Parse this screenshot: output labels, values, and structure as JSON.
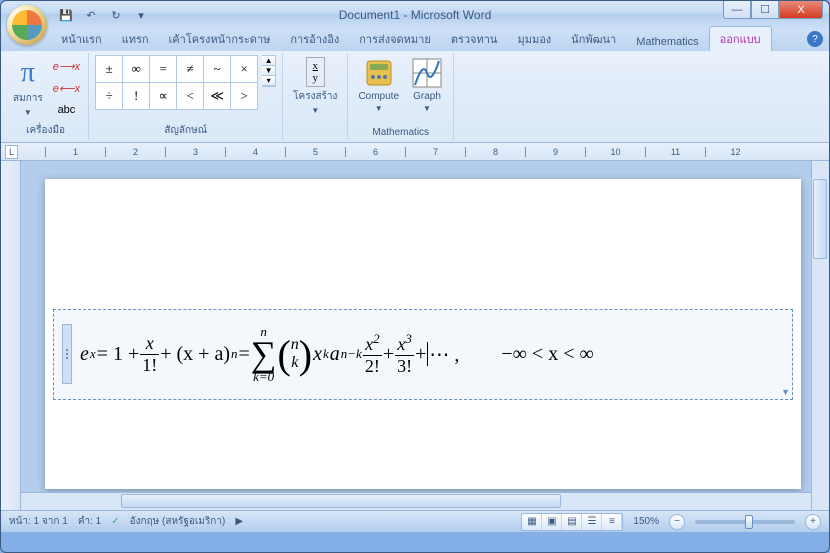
{
  "title": "Document1 - Microsoft Word",
  "tabs": {
    "items": [
      "หน้าแรก",
      "แทรก",
      "เค้าโครงหน้ากระดาษ",
      "การอ้างอิง",
      "การส่งจดหมาย",
      "ตรวจทาน",
      "มุมมอง",
      "นักพัฒนา",
      "Mathematics",
      "ออกแบบ"
    ],
    "active_index": 9
  },
  "ribbon": {
    "tools": {
      "label": "เครื่องมือ",
      "equation": "สมการ",
      "e1": "e⟶x",
      "e2": "e⟵x",
      "abc": "abc"
    },
    "symbols": {
      "label": "สัญลักษณ์",
      "grid": [
        "±",
        "∞",
        "=",
        "≠",
        "~",
        "×",
        "÷",
        "!",
        "∝",
        "<",
        "≪",
        ">"
      ]
    },
    "structures": {
      "label": "โครงสร้าง",
      "frac": "x/y"
    },
    "mathematics": {
      "label": "Mathematics",
      "compute": "Compute",
      "graph": "Graph"
    }
  },
  "ruler_numbers": [
    "1",
    "2",
    "3",
    "4",
    "5",
    "6",
    "7",
    "8",
    "9",
    "10",
    "11",
    "12"
  ],
  "equation": {
    "lhs": "e",
    "lhs_sup": "x",
    "eq": " = 1 + ",
    "f1n": "x",
    "f1d": "1!",
    "plus1": " + (x + a)",
    "sup_n": "n",
    "eq2": " = ",
    "sum_top": "n",
    "sum_bot": "k=0",
    "binom_n": "n",
    "binom_k": "k",
    "mid": " x",
    "mid_sup": "k",
    "mid2": " a",
    "mid2_sup": "n−k",
    "f2n_base": "x",
    "f2n_sup": "2",
    "f2d": "2!",
    "plus2": " + ",
    "f3n_base": "x",
    "f3n_sup": "3",
    "f3d": "3!",
    "plus3": " + ",
    "dots": "⋯ ,",
    "space": "   ",
    "range": "−∞ < x < ∞"
  },
  "status": {
    "page": "หน้า: 1 จาก 1",
    "words": "คำ: 1",
    "lang": "อังกฤษ (สหรัฐอเมริกา)",
    "zoom": "150%"
  }
}
